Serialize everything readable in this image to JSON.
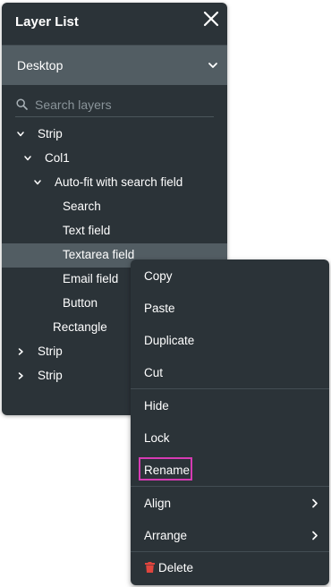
{
  "panel": {
    "title": "Layer List",
    "device": "Desktop",
    "search": {
      "placeholder": "Search layers",
      "value": ""
    }
  },
  "layers": [
    {
      "label": "Strip",
      "indent": 0,
      "chevron": "expanded"
    },
    {
      "label": "Col1",
      "indent": 1,
      "chevron": "expanded"
    },
    {
      "label": "Auto-fit with search field",
      "indent": 2,
      "chevron": "expanded"
    },
    {
      "label": "Search",
      "indent": 3,
      "chevron": "none"
    },
    {
      "label": "Text field",
      "indent": 3,
      "chevron": "none"
    },
    {
      "label": "Textarea field",
      "indent": 3,
      "chevron": "none",
      "selected": true
    },
    {
      "label": "Email field",
      "indent": 3,
      "chevron": "none"
    },
    {
      "label": "Button",
      "indent": 3,
      "chevron": "none"
    },
    {
      "label": "Rectangle",
      "indent": 2,
      "chevron": "none"
    },
    {
      "label": "Strip",
      "indent": 0,
      "chevron": "collapsed"
    },
    {
      "label": "Strip",
      "indent": 0,
      "chevron": "collapsed"
    }
  ],
  "context_menu": {
    "items": [
      {
        "label": "Copy"
      },
      {
        "label": "Paste"
      },
      {
        "label": "Duplicate"
      },
      {
        "label": "Cut"
      },
      {
        "label": "Hide"
      },
      {
        "label": "Lock"
      },
      {
        "label": "Rename",
        "highlighted": true
      },
      {
        "label": "Align",
        "submenu": true
      },
      {
        "label": "Arrange",
        "submenu": true
      },
      {
        "label": "Delete",
        "icon": "trash-icon"
      }
    ]
  },
  "colors": {
    "panel_bg": "#2b3338",
    "selected_bg": "#525d63",
    "highlight_border": "#d63bb3",
    "delete_icon": "#e0453e"
  }
}
